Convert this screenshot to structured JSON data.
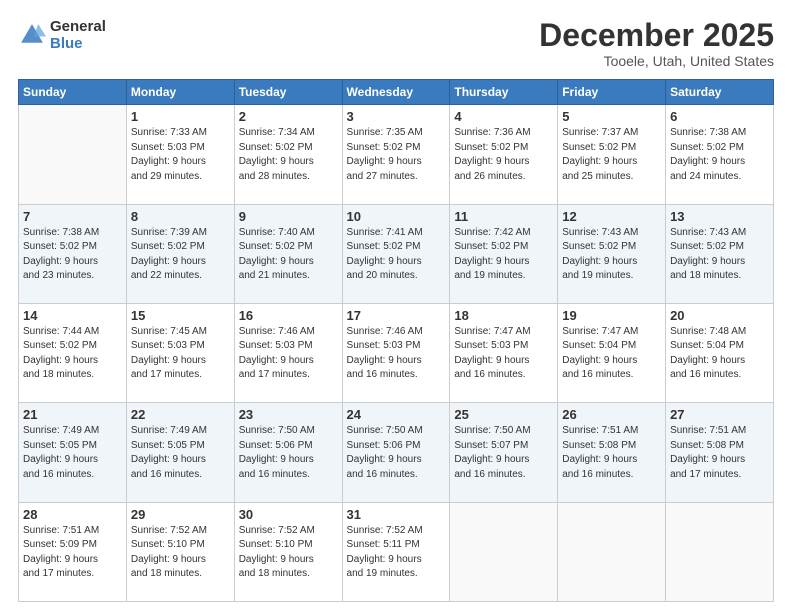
{
  "header": {
    "logo_line1": "General",
    "logo_line2": "Blue",
    "main_title": "December 2025",
    "subtitle": "Tooele, Utah, United States"
  },
  "days_of_week": [
    "Sunday",
    "Monday",
    "Tuesday",
    "Wednesday",
    "Thursday",
    "Friday",
    "Saturday"
  ],
  "weeks": [
    [
      {
        "day": "",
        "info": ""
      },
      {
        "day": "1",
        "info": "Sunrise: 7:33 AM\nSunset: 5:03 PM\nDaylight: 9 hours\nand 29 minutes."
      },
      {
        "day": "2",
        "info": "Sunrise: 7:34 AM\nSunset: 5:02 PM\nDaylight: 9 hours\nand 28 minutes."
      },
      {
        "day": "3",
        "info": "Sunrise: 7:35 AM\nSunset: 5:02 PM\nDaylight: 9 hours\nand 27 minutes."
      },
      {
        "day": "4",
        "info": "Sunrise: 7:36 AM\nSunset: 5:02 PM\nDaylight: 9 hours\nand 26 minutes."
      },
      {
        "day": "5",
        "info": "Sunrise: 7:37 AM\nSunset: 5:02 PM\nDaylight: 9 hours\nand 25 minutes."
      },
      {
        "day": "6",
        "info": "Sunrise: 7:38 AM\nSunset: 5:02 PM\nDaylight: 9 hours\nand 24 minutes."
      }
    ],
    [
      {
        "day": "7",
        "info": "Sunrise: 7:38 AM\nSunset: 5:02 PM\nDaylight: 9 hours\nand 23 minutes."
      },
      {
        "day": "8",
        "info": "Sunrise: 7:39 AM\nSunset: 5:02 PM\nDaylight: 9 hours\nand 22 minutes."
      },
      {
        "day": "9",
        "info": "Sunrise: 7:40 AM\nSunset: 5:02 PM\nDaylight: 9 hours\nand 21 minutes."
      },
      {
        "day": "10",
        "info": "Sunrise: 7:41 AM\nSunset: 5:02 PM\nDaylight: 9 hours\nand 20 minutes."
      },
      {
        "day": "11",
        "info": "Sunrise: 7:42 AM\nSunset: 5:02 PM\nDaylight: 9 hours\nand 19 minutes."
      },
      {
        "day": "12",
        "info": "Sunrise: 7:43 AM\nSunset: 5:02 PM\nDaylight: 9 hours\nand 19 minutes."
      },
      {
        "day": "13",
        "info": "Sunrise: 7:43 AM\nSunset: 5:02 PM\nDaylight: 9 hours\nand 18 minutes."
      }
    ],
    [
      {
        "day": "14",
        "info": "Sunrise: 7:44 AM\nSunset: 5:02 PM\nDaylight: 9 hours\nand 18 minutes."
      },
      {
        "day": "15",
        "info": "Sunrise: 7:45 AM\nSunset: 5:03 PM\nDaylight: 9 hours\nand 17 minutes."
      },
      {
        "day": "16",
        "info": "Sunrise: 7:46 AM\nSunset: 5:03 PM\nDaylight: 9 hours\nand 17 minutes."
      },
      {
        "day": "17",
        "info": "Sunrise: 7:46 AM\nSunset: 5:03 PM\nDaylight: 9 hours\nand 16 minutes."
      },
      {
        "day": "18",
        "info": "Sunrise: 7:47 AM\nSunset: 5:03 PM\nDaylight: 9 hours\nand 16 minutes."
      },
      {
        "day": "19",
        "info": "Sunrise: 7:47 AM\nSunset: 5:04 PM\nDaylight: 9 hours\nand 16 minutes."
      },
      {
        "day": "20",
        "info": "Sunrise: 7:48 AM\nSunset: 5:04 PM\nDaylight: 9 hours\nand 16 minutes."
      }
    ],
    [
      {
        "day": "21",
        "info": "Sunrise: 7:49 AM\nSunset: 5:05 PM\nDaylight: 9 hours\nand 16 minutes."
      },
      {
        "day": "22",
        "info": "Sunrise: 7:49 AM\nSunset: 5:05 PM\nDaylight: 9 hours\nand 16 minutes."
      },
      {
        "day": "23",
        "info": "Sunrise: 7:50 AM\nSunset: 5:06 PM\nDaylight: 9 hours\nand 16 minutes."
      },
      {
        "day": "24",
        "info": "Sunrise: 7:50 AM\nSunset: 5:06 PM\nDaylight: 9 hours\nand 16 minutes."
      },
      {
        "day": "25",
        "info": "Sunrise: 7:50 AM\nSunset: 5:07 PM\nDaylight: 9 hours\nand 16 minutes."
      },
      {
        "day": "26",
        "info": "Sunrise: 7:51 AM\nSunset: 5:08 PM\nDaylight: 9 hours\nand 16 minutes."
      },
      {
        "day": "27",
        "info": "Sunrise: 7:51 AM\nSunset: 5:08 PM\nDaylight: 9 hours\nand 17 minutes."
      }
    ],
    [
      {
        "day": "28",
        "info": "Sunrise: 7:51 AM\nSunset: 5:09 PM\nDaylight: 9 hours\nand 17 minutes."
      },
      {
        "day": "29",
        "info": "Sunrise: 7:52 AM\nSunset: 5:10 PM\nDaylight: 9 hours\nand 18 minutes."
      },
      {
        "day": "30",
        "info": "Sunrise: 7:52 AM\nSunset: 5:10 PM\nDaylight: 9 hours\nand 18 minutes."
      },
      {
        "day": "31",
        "info": "Sunrise: 7:52 AM\nSunset: 5:11 PM\nDaylight: 9 hours\nand 19 minutes."
      },
      {
        "day": "",
        "info": ""
      },
      {
        "day": "",
        "info": ""
      },
      {
        "day": "",
        "info": ""
      }
    ]
  ]
}
